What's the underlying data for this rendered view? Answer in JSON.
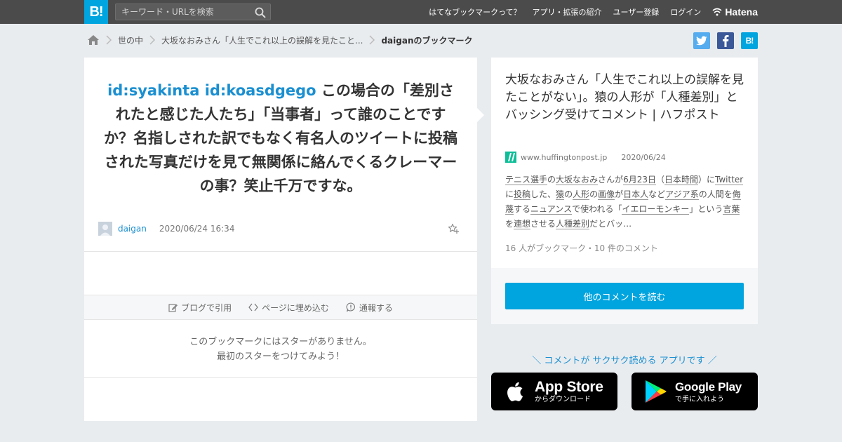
{
  "header": {
    "logo": "B!",
    "search_placeholder": "キーワード・URLを検索",
    "nav": [
      {
        "label": "はてなブックマークって？"
      },
      {
        "label": "アプリ・拡張の紹介"
      },
      {
        "label": "ユーザー登録"
      },
      {
        "label": "ログイン"
      }
    ],
    "brand": "Hatena"
  },
  "breadcrumb": {
    "items": [
      "世の中",
      "大坂なおみさん「人生でこれ以上の誤解を見たこと..."
    ],
    "current": "daiganのブックマーク"
  },
  "social": {
    "twitter": "t",
    "facebook": "f",
    "hatebu": "B!"
  },
  "bookmark": {
    "comment_ids": "id:syakinta id:koasdgego",
    "comment_text": " この場合の「差別されたと感じた人たち」「当事者」って誰のことですか？名指しされた訳でもなく有名人のツイートに投稿された写真だけを見て無関係に絡んでくるクレーマーの事？笑止千万ですな。",
    "user": "daigan",
    "datetime": "2020/06/24 16:34"
  },
  "actions": {
    "blog": "ブログで引用",
    "embed": "ページに埋め込む",
    "report": "通報する"
  },
  "nostar": {
    "line1": "このブックマークにはスターがありません。",
    "line2": "最初のスターをつけてみよう！"
  },
  "entry": {
    "title": "大坂なおみさん「人生でこれ以上の誤解を見たことがない」。猿の人形が「人種差別」とバッシング受けてコメント | ハフポスト",
    "domain": "www.huffingtonpost.jp",
    "date": "2020/06/24",
    "summary": [
      {
        "t": "テニス選手",
        "u": true
      },
      {
        "t": "の",
        "u": false
      },
      {
        "t": "大坂なおみ",
        "u": true
      },
      {
        "t": "さんが",
        "u": false
      },
      {
        "t": "6月23日",
        "u": true
      },
      {
        "t": "（",
        "u": false
      },
      {
        "t": "日本時間",
        "u": true
      },
      {
        "t": "）に",
        "u": false
      },
      {
        "t": "Twitter",
        "u": true
      },
      {
        "t": "に",
        "u": false
      },
      {
        "t": "投稿",
        "u": true
      },
      {
        "t": "した、",
        "u": false
      },
      {
        "t": "猿",
        "u": true
      },
      {
        "t": "の",
        "u": false
      },
      {
        "t": "人形",
        "u": true
      },
      {
        "t": "の",
        "u": false
      },
      {
        "t": "画像",
        "u": true
      },
      {
        "t": "が",
        "u": false
      },
      {
        "t": "日本人",
        "u": true
      },
      {
        "t": "など",
        "u": false
      },
      {
        "t": "アジア系",
        "u": true
      },
      {
        "t": "の人間を",
        "u": false
      },
      {
        "t": "侮蔑",
        "u": true
      },
      {
        "t": "する",
        "u": false
      },
      {
        "t": "ニュアンス",
        "u": true
      },
      {
        "t": "で使われる「",
        "u": false
      },
      {
        "t": "イエローモンキー",
        "u": true
      },
      {
        "t": "」という",
        "u": false
      },
      {
        "t": "言葉",
        "u": true
      },
      {
        "t": "を",
        "u": false
      },
      {
        "t": "連想",
        "u": true
      },
      {
        "t": "させる",
        "u": false
      },
      {
        "t": "人種差別",
        "u": true
      },
      {
        "t": "だとバッ…",
        "u": false
      }
    ],
    "counts": "16 人がブックマーク・10 件のコメント",
    "read_more": "他のコメントを読む"
  },
  "promo": {
    "text": "＼ コメントが サクサク読める アプリです ／",
    "apple_main": "App Store",
    "apple_sub": "からダウンロード",
    "google_main": "Google Play",
    "google_sub": "で手に入れよう"
  },
  "colors": {
    "accent": "#00a4de",
    "link": "#1a8fd1",
    "topbar": "#4b4b4b"
  }
}
